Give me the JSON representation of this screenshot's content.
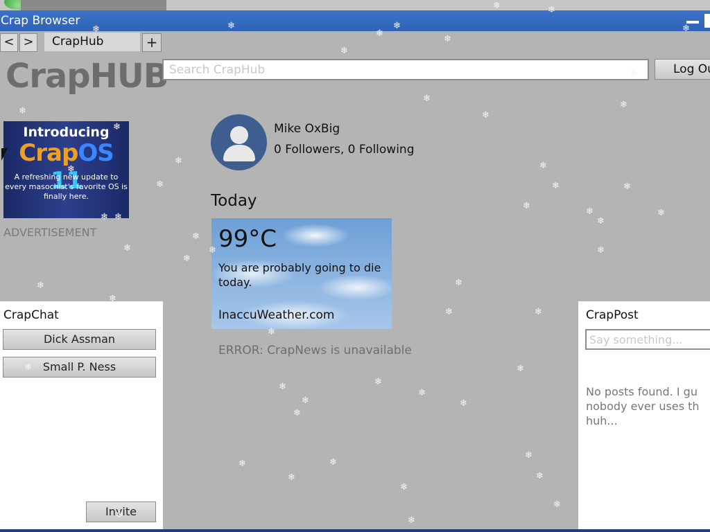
{
  "window": {
    "title": "Crap Browser"
  },
  "tabbar": {
    "back": "<",
    "forward": ">",
    "tab_label": "CrapHub",
    "new_tab": "+"
  },
  "header": {
    "logo": "CrapHUB",
    "search_placeholder": "Search CrapHub",
    "login_label": "Log Out"
  },
  "ad": {
    "intro": "Introducing",
    "os_crap": "Crap",
    "os_os": "OS",
    "os_version": "11",
    "description": "A refreshing new update to every masochist's favorite OS is finally here.",
    "label": "ADVERTISEMENT"
  },
  "profile": {
    "name": "Mike OxBig",
    "stats": "0 Followers, 0 Following"
  },
  "feed": {
    "today_label": "Today",
    "weather": {
      "temp": "99°C",
      "message": "You are probably going to die today.",
      "source": "InaccuWeather.com"
    },
    "news_error": "ERROR: CrapNews is unavailable"
  },
  "chat": {
    "title": "CrapChat",
    "contacts": [
      "Dick Assman",
      "Small P. Ness"
    ],
    "invite_label": "Invite"
  },
  "posts": {
    "title": "CrapPost",
    "input_placeholder": "Say something...",
    "empty_message": "No posts found. I guess nobody ever uses this, huh..."
  },
  "colors": {
    "title_bar": "#2f63b6",
    "page_bg": "#b4b4b4",
    "avatar": "#3e5e90"
  }
}
